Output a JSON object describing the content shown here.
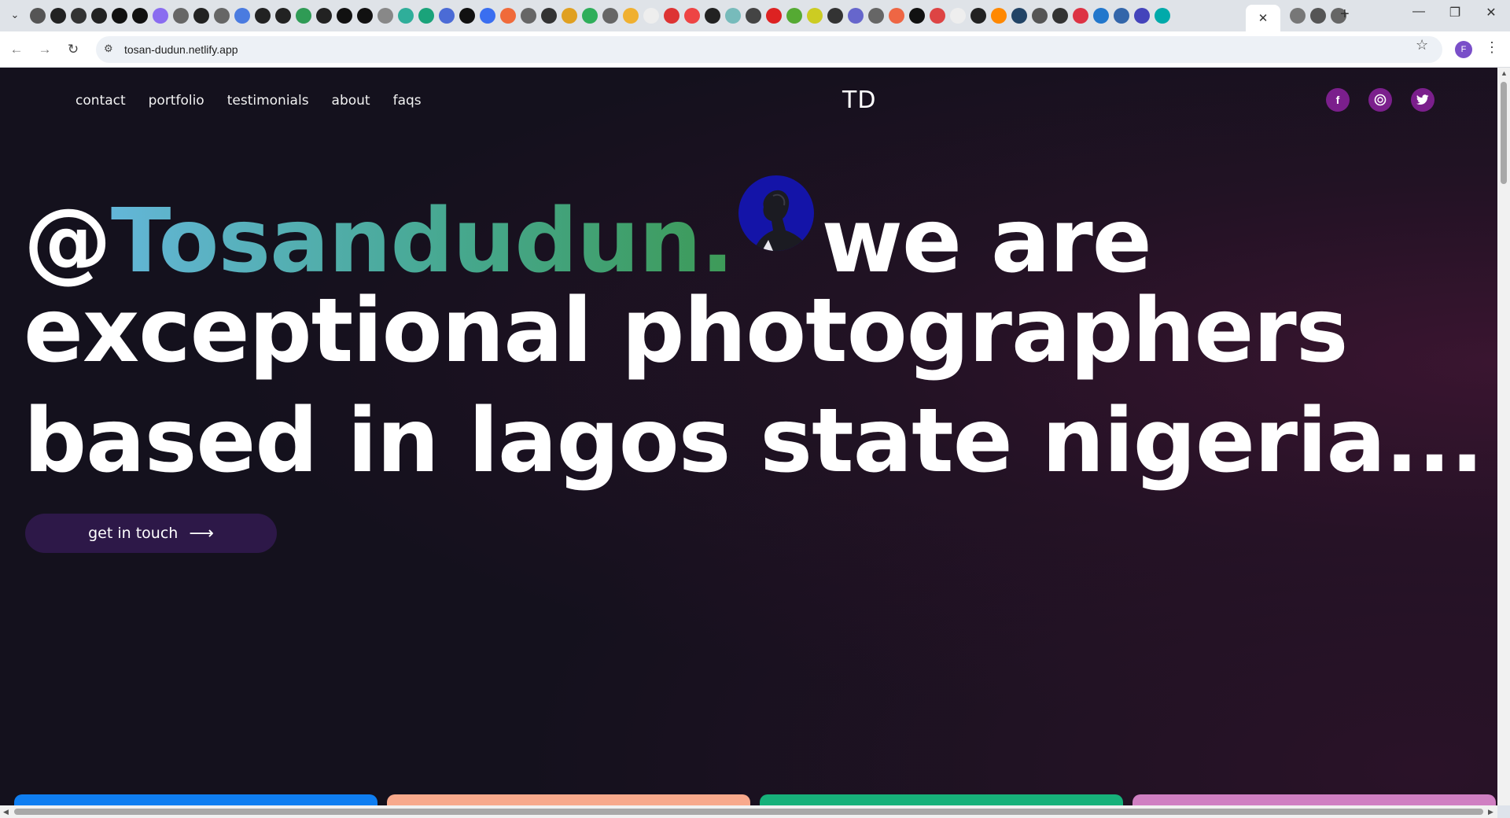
{
  "browser": {
    "url": "tosan-dudun.netlify.app",
    "profile_initial": "F",
    "active_tab_close": "✕",
    "new_tab": "+",
    "controls": {
      "minimize": "—",
      "restore": "❐",
      "close": "✕"
    }
  },
  "site": {
    "nav": [
      "contact",
      "portfolio",
      "testimonials",
      "about",
      "faqs"
    ],
    "logo": "TD",
    "social": [
      {
        "icon": "facebook-icon",
        "glyph": "f"
      },
      {
        "icon": "dribbble-icon",
        "glyph": "◎"
      },
      {
        "icon": "twitter-icon",
        "glyph": "🐦"
      }
    ],
    "hero": {
      "at": "@",
      "handle": "Tosandudun.",
      "tail1": "we are",
      "line2": "exceptional photographers",
      "line3": "based in lagos state nigeria..."
    },
    "cta": {
      "label": "get in touch",
      "arrow": "⟶"
    },
    "card_colors": [
      "#0f7ef1",
      "#f8a98c",
      "#17b17a",
      "#d07fc2"
    ]
  }
}
